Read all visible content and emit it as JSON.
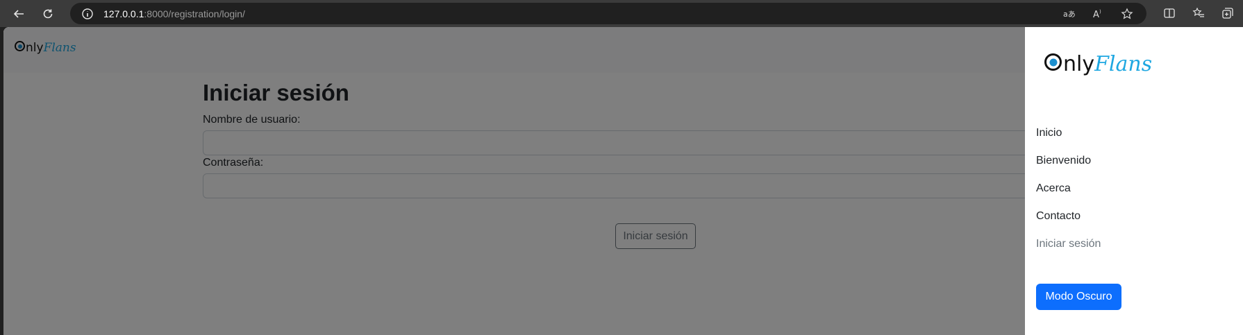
{
  "browser": {
    "url_host": "127.0.0.1",
    "url_rest": ":8000/registration/login/",
    "icons": [
      "back-icon",
      "reload-icon",
      "info-icon",
      "translate-icon",
      "read-aloud-icon",
      "favorite-star-icon",
      "split-screen-icon",
      "favorites-icon",
      "collections-icon"
    ]
  },
  "brand": {
    "only": "nly",
    "flans": "Flans",
    "accent": "#1ea7e1"
  },
  "page": {
    "title": "Iniciar sesión",
    "username_label": "Nombre de usuario:",
    "username_value": "",
    "password_label": "Contraseña:",
    "password_value": "",
    "submit_label": "Iniciar sesión"
  },
  "sidebar": {
    "items": [
      {
        "label": "Inicio"
      },
      {
        "label": "Bienvenido"
      },
      {
        "label": "Acerca"
      },
      {
        "label": "Contacto"
      },
      {
        "label": "Iniciar sesión"
      }
    ],
    "dark_mode_label": "Modo Oscuro",
    "dark_mode_color": "#0d6efd"
  }
}
